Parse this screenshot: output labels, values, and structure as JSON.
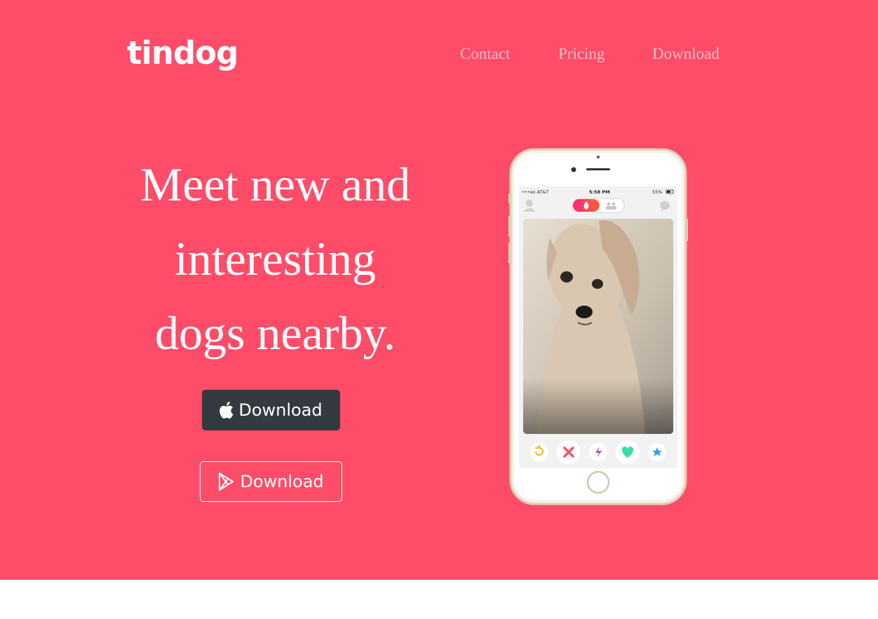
{
  "brand": {
    "name": "tindog"
  },
  "nav": {
    "items": [
      {
        "label": "Contact"
      },
      {
        "label": "Pricing"
      },
      {
        "label": "Download"
      }
    ]
  },
  "hero": {
    "headline_lines": [
      "Meet new and",
      "interesting",
      "dogs nearby."
    ],
    "buttons": [
      {
        "label": "Download",
        "icon": "apple-icon",
        "style": "dark"
      },
      {
        "label": "Download",
        "icon": "google-play-icon",
        "style": "outline"
      }
    ]
  },
  "phone": {
    "status": {
      "carrier": "•••oo AT&T",
      "time": "5:58 PM",
      "battery": "55%"
    },
    "action_icons": [
      "rewind-icon",
      "nope-icon",
      "boost-icon",
      "like-icon",
      "superlike-icon"
    ]
  },
  "colors": {
    "hero_bg": "#ff4c68",
    "dark_button": "#343a40",
    "white": "#ffffff"
  }
}
